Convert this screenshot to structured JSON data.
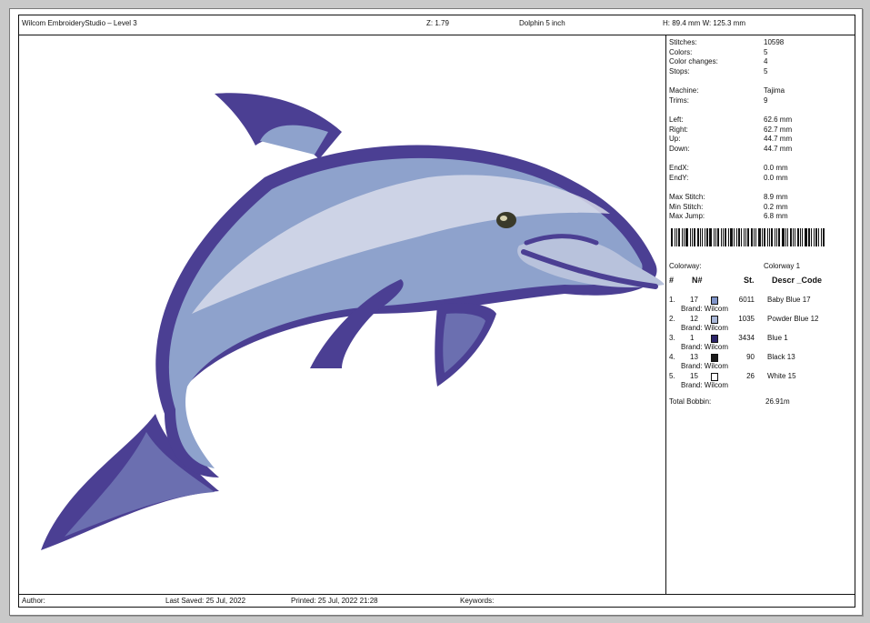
{
  "header": {
    "app": "Wilcom EmbroideryStudio – Level 3",
    "zoom": "Z: 1.79",
    "design": "Dolphin 5 inch",
    "size": "H: 89.4 mm  W: 125.3 mm"
  },
  "stats": [
    {
      "label": "Stitches:",
      "value": "10598"
    },
    {
      "label": "Colors:",
      "value": "5"
    },
    {
      "label": "Color changes:",
      "value": "4"
    },
    {
      "label": "Stops:",
      "value": "5"
    },
    {
      "label": "Machine:",
      "value": "Tajima"
    },
    {
      "label": "Trims:",
      "value": "9"
    },
    {
      "label": "Left:",
      "value": "62.6 mm"
    },
    {
      "label": "Right:",
      "value": "62.7 mm"
    },
    {
      "label": "Up:",
      "value": "44.7 mm"
    },
    {
      "label": "Down:",
      "value": "44.7 mm"
    },
    {
      "label": "EndX:",
      "value": "0.0 mm"
    },
    {
      "label": "EndY:",
      "value": "0.0 mm"
    },
    {
      "label": "Max Stitch:",
      "value": "8.9 mm"
    },
    {
      "label": "Min Stitch:",
      "value": "0.2 mm"
    },
    {
      "label": "Max Jump:",
      "value": "6.8 mm"
    }
  ],
  "colorway": {
    "label": "Colorway:",
    "value": "Colorway 1"
  },
  "table_headers": {
    "num": "#",
    "n": "N#",
    "st": "St.",
    "descr": "Descr _Code"
  },
  "colors": [
    {
      "num": "1.",
      "n": "17",
      "st": "6011",
      "descr": "Baby Blue 17",
      "brand": "Brand: Wilcom",
      "swatch": "#7f94c9"
    },
    {
      "num": "2.",
      "n": "12",
      "st": "1035",
      "descr": "Powder Blue 12",
      "brand": "Brand: Wilcom",
      "swatch": "#a8b6d6"
    },
    {
      "num": "3.",
      "n": "1",
      "st": "3434",
      "descr": "Blue 1",
      "brand": "Brand: Wilcom",
      "swatch": "#2c2468"
    },
    {
      "num": "4.",
      "n": "13",
      "st": "90",
      "descr": "Black 13",
      "brand": "Brand: Wilcom",
      "swatch": "#1a1a1a"
    },
    {
      "num": "5.",
      "n": "15",
      "st": "26",
      "descr": "White 15",
      "brand": "Brand: Wilcom",
      "swatch": "#ffffff"
    }
  ],
  "bobbin": {
    "label": "Total Bobbin:",
    "value": "26.91m"
  },
  "footer": {
    "author": "Author:",
    "saved": "Last Saved: 25 Jul, 2022",
    "printed": "Printed: 25 Jul, 2022 21:28",
    "keywords": "Keywords:"
  },
  "design_colors": {
    "body": "#8ea2cc",
    "highlight": "#d8dcea",
    "outline": "#4b3f93",
    "eye": "#3a3a2a"
  }
}
